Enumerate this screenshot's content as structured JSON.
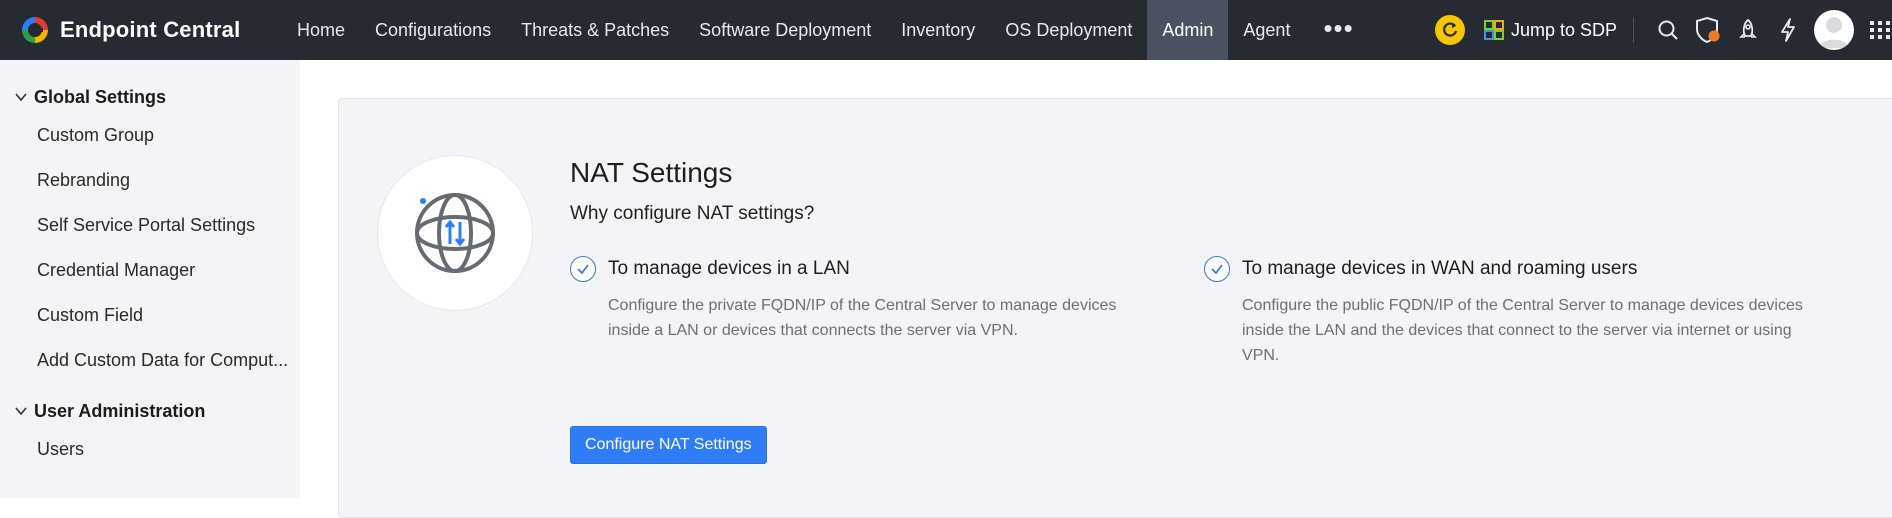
{
  "app": {
    "name": "Endpoint Central"
  },
  "nav": {
    "items": [
      {
        "label": "Home"
      },
      {
        "label": "Configurations"
      },
      {
        "label": "Threats & Patches"
      },
      {
        "label": "Software Deployment"
      },
      {
        "label": "Inventory"
      },
      {
        "label": "OS Deployment"
      },
      {
        "label": "Admin",
        "active": true
      },
      {
        "label": "Agent"
      }
    ],
    "more_label": "•••"
  },
  "topright": {
    "jump_label": "Jump to SDP",
    "icons": [
      "refresh-icon",
      "sdp-icon",
      "search-icon",
      "shield-alert-icon",
      "rocket-icon",
      "lightning-icon",
      "avatar",
      "app-grid-icon"
    ]
  },
  "sidebar": {
    "sections": [
      {
        "title": "Global Settings",
        "items": [
          "Custom Group",
          "Rebranding",
          "Self Service Portal Settings",
          "Credential Manager",
          "Custom Field",
          "Add Custom Data for Comput..."
        ]
      },
      {
        "title": "User Administration",
        "items": [
          "Users"
        ]
      }
    ]
  },
  "main": {
    "title": "NAT Settings",
    "subtitle": "Why configure NAT settings?",
    "features": [
      {
        "title": "To manage devices in a LAN",
        "description": "Configure the private FQDN/IP of the Central Server to manage devices inside a LAN or devices that connects the server via VPN."
      },
      {
        "title": "To manage devices in WAN and roaming users",
        "description": "Configure the public FQDN/IP of the Central Server to manage devices devices inside the LAN and the devices that connect to the server via internet or using VPN."
      }
    ],
    "button_label": "Configure NAT Settings"
  },
  "colors": {
    "topbar": "#262a33",
    "active_nav": "#4a5160",
    "accent": "#2f7df6",
    "sidebar_bg": "#f3f4f7",
    "refresh_yellow": "#f7c600"
  }
}
